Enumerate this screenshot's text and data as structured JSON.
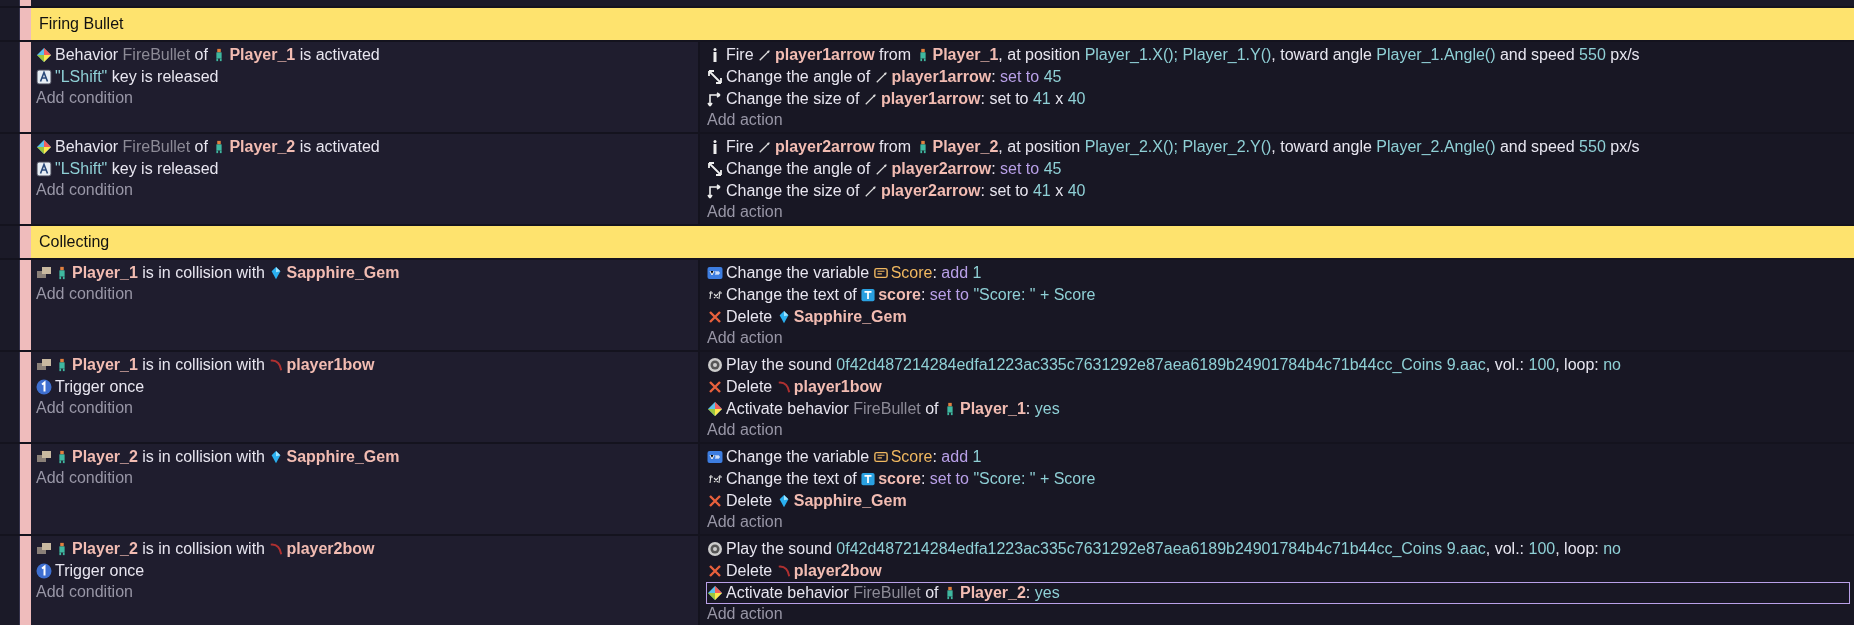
{
  "sections": [
    {
      "title": "Firing Bullet",
      "events": [
        {
          "conditions": [
            {
              "kind": "behavior",
              "selected": false,
              "parts": [
                {
                  "kind": "text",
                  "text": "Behavior "
                },
                {
                  "kind": "behavior",
                  "text": "FireBullet"
                },
                {
                  "kind": "text",
                  "text": " of "
                },
                {
                  "kind": "player",
                  "text": "Player_1"
                },
                {
                  "kind": "text",
                  "text": " is activated"
                }
              ]
            },
            {
              "kind": "key",
              "selected": false,
              "parts": [
                {
                  "kind": "param",
                  "text": "\"LShift\""
                },
                {
                  "kind": "text",
                  "text": " key is released"
                }
              ]
            }
          ],
          "add_condition": "Add condition",
          "actions": [
            {
              "kind": "fire",
              "selected": false,
              "parts": [
                {
                  "kind": "text",
                  "text": "Fire "
                },
                {
                  "kind": "arrow",
                  "text": "player1arrow"
                },
                {
                  "kind": "text",
                  "text": " from "
                },
                {
                  "kind": "player",
                  "text": "Player_1"
                },
                {
                  "kind": "text",
                  "text": ", at position "
                },
                {
                  "kind": "param",
                  "text": "Player_1.X(); Player_1.Y()"
                },
                {
                  "kind": "text",
                  "text": ", toward angle "
                },
                {
                  "kind": "param",
                  "text": "Player_1.Angle()"
                },
                {
                  "kind": "text",
                  "text": " and speed "
                },
                {
                  "kind": "param",
                  "text": "550"
                },
                {
                  "kind": "text",
                  "text": " px/s"
                }
              ]
            },
            {
              "kind": "angle",
              "selected": false,
              "parts": [
                {
                  "kind": "text",
                  "text": "Change the angle of "
                },
                {
                  "kind": "arrow",
                  "text": "player1arrow"
                },
                {
                  "kind": "text",
                  "text": ": "
                },
                {
                  "kind": "keyword",
                  "text": "set to"
                },
                {
                  "kind": "param",
                  "text": "45"
                }
              ]
            },
            {
              "kind": "size",
              "selected": false,
              "parts": [
                {
                  "kind": "text",
                  "text": "Change the size of "
                },
                {
                  "kind": "arrow",
                  "text": "player1arrow"
                },
                {
                  "kind": "text",
                  "text": ": set to "
                },
                {
                  "kind": "param",
                  "text": "41"
                },
                {
                  "kind": "text",
                  "text": " x "
                },
                {
                  "kind": "param",
                  "text": "40"
                }
              ]
            }
          ],
          "add_action": "Add action"
        },
        {
          "conditions": [
            {
              "kind": "behavior",
              "selected": false,
              "parts": [
                {
                  "kind": "text",
                  "text": "Behavior "
                },
                {
                  "kind": "behavior",
                  "text": "FireBullet"
                },
                {
                  "kind": "text",
                  "text": " of "
                },
                {
                  "kind": "player",
                  "text": "Player_2"
                },
                {
                  "kind": "text",
                  "text": " is activated"
                }
              ]
            },
            {
              "kind": "key",
              "selected": false,
              "parts": [
                {
                  "kind": "param",
                  "text": "\"LShift\""
                },
                {
                  "kind": "text",
                  "text": " key is released"
                }
              ]
            }
          ],
          "add_condition": "Add condition",
          "actions": [
            {
              "kind": "fire",
              "selected": false,
              "parts": [
                {
                  "kind": "text",
                  "text": "Fire "
                },
                {
                  "kind": "arrow",
                  "text": "player2arrow"
                },
                {
                  "kind": "text",
                  "text": " from "
                },
                {
                  "kind": "player",
                  "text": "Player_2"
                },
                {
                  "kind": "text",
                  "text": ", at position "
                },
                {
                  "kind": "param",
                  "text": "Player_2.X(); Player_2.Y()"
                },
                {
                  "kind": "text",
                  "text": ", toward angle "
                },
                {
                  "kind": "param",
                  "text": "Player_2.Angle()"
                },
                {
                  "kind": "text",
                  "text": " and speed "
                },
                {
                  "kind": "param",
                  "text": "550"
                },
                {
                  "kind": "text",
                  "text": " px/s"
                }
              ]
            },
            {
              "kind": "angle",
              "selected": false,
              "parts": [
                {
                  "kind": "text",
                  "text": "Change the angle of "
                },
                {
                  "kind": "arrow",
                  "text": "player2arrow"
                },
                {
                  "kind": "text",
                  "text": ": "
                },
                {
                  "kind": "keyword",
                  "text": "set to"
                },
                {
                  "kind": "param",
                  "text": "45"
                }
              ]
            },
            {
              "kind": "size",
              "selected": false,
              "parts": [
                {
                  "kind": "text",
                  "text": "Change the size of "
                },
                {
                  "kind": "arrow",
                  "text": "player2arrow"
                },
                {
                  "kind": "text",
                  "text": ": set to "
                },
                {
                  "kind": "param",
                  "text": "41"
                },
                {
                  "kind": "text",
                  "text": " x "
                },
                {
                  "kind": "param",
                  "text": "40"
                }
              ]
            }
          ],
          "add_action": "Add action"
        }
      ]
    },
    {
      "title": "Collecting",
      "events": [
        {
          "conditions": [
            {
              "kind": "collision",
              "selected": false,
              "parts": [
                {
                  "kind": "player",
                  "text": "Player_1"
                },
                {
                  "kind": "text",
                  "text": " is in collision with "
                },
                {
                  "kind": "gem",
                  "text": "Sapphire_Gem"
                }
              ]
            }
          ],
          "add_condition": "Add condition",
          "actions": [
            {
              "kind": "variable",
              "selected": false,
              "parts": [
                {
                  "kind": "text",
                  "text": "Change the variable "
                },
                {
                  "kind": "variable",
                  "text": "Score"
                },
                {
                  "kind": "text",
                  "text": ": "
                },
                {
                  "kind": "keyword",
                  "text": "add"
                },
                {
                  "kind": "param",
                  "text": "1"
                }
              ]
            },
            {
              "kind": "text",
              "selected": false,
              "parts": [
                {
                  "kind": "text",
                  "text": "Change the text of "
                },
                {
                  "kind": "textobj",
                  "text": "score"
                },
                {
                  "kind": "text",
                  "text": ": "
                },
                {
                  "kind": "keyword",
                  "text": "set to"
                },
                {
                  "kind": "param",
                  "text": "\"Score: \" + Score"
                }
              ]
            },
            {
              "kind": "delete",
              "selected": false,
              "parts": [
                {
                  "kind": "text",
                  "text": "Delete "
                },
                {
                  "kind": "gem",
                  "text": "Sapphire_Gem"
                }
              ]
            }
          ],
          "add_action": "Add action"
        },
        {
          "conditions": [
            {
              "kind": "collision",
              "selected": false,
              "parts": [
                {
                  "kind": "player",
                  "text": "Player_1"
                },
                {
                  "kind": "text",
                  "text": " is in collision with "
                },
                {
                  "kind": "bow",
                  "text": "player1bow"
                }
              ]
            },
            {
              "kind": "trigger",
              "selected": false,
              "parts": [
                {
                  "kind": "text",
                  "text": "Trigger once"
                }
              ]
            }
          ],
          "add_condition": "Add condition",
          "actions": [
            {
              "kind": "sound",
              "selected": false,
              "parts": [
                {
                  "kind": "text",
                  "text": "Play the sound "
                },
                {
                  "kind": "param",
                  "text": "0f42d487214284edfa1223ac335c7631292e87aea6189b24901784b4c71b44cc_Coins 9.aac"
                },
                {
                  "kind": "text",
                  "text": ", vol.: "
                },
                {
                  "kind": "param",
                  "text": "100"
                },
                {
                  "kind": "text",
                  "text": ", loop: "
                },
                {
                  "kind": "param",
                  "text": "no"
                }
              ]
            },
            {
              "kind": "delete",
              "selected": false,
              "parts": [
                {
                  "kind": "text",
                  "text": "Delete "
                },
                {
                  "kind": "bow",
                  "text": "player1bow"
                }
              ]
            },
            {
              "kind": "behavior",
              "selected": false,
              "parts": [
                {
                  "kind": "text",
                  "text": "Activate behavior "
                },
                {
                  "kind": "behavior",
                  "text": "FireBullet"
                },
                {
                  "kind": "text",
                  "text": " of "
                },
                {
                  "kind": "player",
                  "text": "Player_1"
                },
                {
                  "kind": "text",
                  "text": ": "
                },
                {
                  "kind": "param",
                  "text": "yes"
                }
              ]
            }
          ],
          "add_action": "Add action"
        },
        {
          "conditions": [
            {
              "kind": "collision",
              "selected": false,
              "parts": [
                {
                  "kind": "player",
                  "text": "Player_2"
                },
                {
                  "kind": "text",
                  "text": " is in collision with "
                },
                {
                  "kind": "gem",
                  "text": "Sapphire_Gem"
                }
              ]
            }
          ],
          "add_condition": "Add condition",
          "actions": [
            {
              "kind": "variable",
              "selected": false,
              "parts": [
                {
                  "kind": "text",
                  "text": "Change the variable "
                },
                {
                  "kind": "variable",
                  "text": "Score"
                },
                {
                  "kind": "text",
                  "text": ": "
                },
                {
                  "kind": "keyword",
                  "text": "add"
                },
                {
                  "kind": "param",
                  "text": "1"
                }
              ]
            },
            {
              "kind": "text",
              "selected": false,
              "parts": [
                {
                  "kind": "text",
                  "text": "Change the text of "
                },
                {
                  "kind": "textobj",
                  "text": "score"
                },
                {
                  "kind": "text",
                  "text": ": "
                },
                {
                  "kind": "keyword",
                  "text": "set to"
                },
                {
                  "kind": "param",
                  "text": "\"Score: \" + Score"
                }
              ]
            },
            {
              "kind": "delete",
              "selected": false,
              "parts": [
                {
                  "kind": "text",
                  "text": "Delete "
                },
                {
                  "kind": "gem",
                  "text": "Sapphire_Gem"
                }
              ]
            }
          ],
          "add_action": "Add action"
        },
        {
          "conditions": [
            {
              "kind": "collision",
              "selected": false,
              "parts": [
                {
                  "kind": "player",
                  "text": "Player_2"
                },
                {
                  "kind": "text",
                  "text": " is in collision with "
                },
                {
                  "kind": "bow",
                  "text": "player2bow"
                }
              ]
            },
            {
              "kind": "trigger",
              "selected": false,
              "parts": [
                {
                  "kind": "text",
                  "text": "Trigger once"
                }
              ]
            }
          ],
          "add_condition": "Add condition",
          "actions": [
            {
              "kind": "sound",
              "selected": false,
              "parts": [
                {
                  "kind": "text",
                  "text": "Play the sound "
                },
                {
                  "kind": "param",
                  "text": "0f42d487214284edfa1223ac335c7631292e87aea6189b24901784b4c71b44cc_Coins 9.aac"
                },
                {
                  "kind": "text",
                  "text": ", vol.: "
                },
                {
                  "kind": "param",
                  "text": "100"
                },
                {
                  "kind": "text",
                  "text": ", loop: "
                },
                {
                  "kind": "param",
                  "text": "no"
                }
              ]
            },
            {
              "kind": "delete",
              "selected": false,
              "parts": [
                {
                  "kind": "text",
                  "text": "Delete "
                },
                {
                  "kind": "bow",
                  "text": "player2bow"
                }
              ]
            },
            {
              "kind": "behavior",
              "selected": true,
              "parts": [
                {
                  "kind": "text",
                  "text": "Activate behavior "
                },
                {
                  "kind": "behavior",
                  "text": "FireBullet"
                },
                {
                  "kind": "text",
                  "text": " of "
                },
                {
                  "kind": "player",
                  "text": "Player_2"
                },
                {
                  "kind": "text",
                  "text": ": "
                },
                {
                  "kind": "param",
                  "text": "yes"
                }
              ]
            }
          ],
          "add_action": "Add action"
        }
      ]
    }
  ]
}
